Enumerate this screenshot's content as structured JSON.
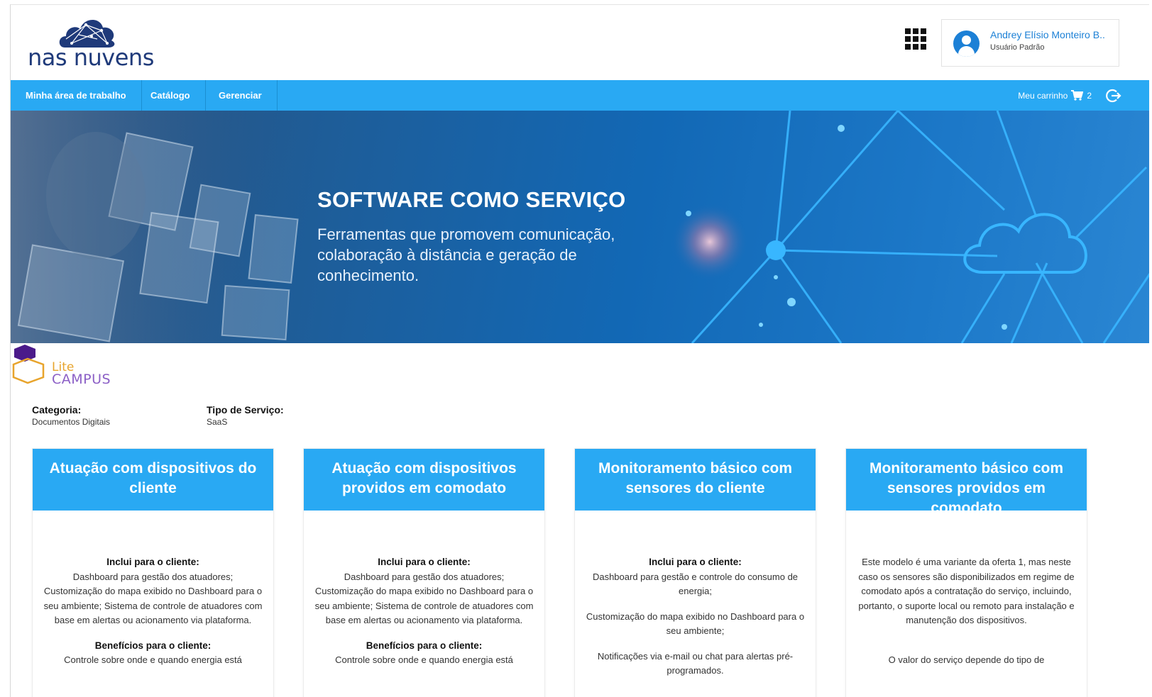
{
  "brand": {
    "logo_text": "nas nuvens"
  },
  "user": {
    "name": "Andrey Elísio Monteiro B..",
    "role": "Usuário Padrão"
  },
  "nav": {
    "items": [
      "Minha área de trabalho",
      "Catálogo",
      "Gerenciar"
    ],
    "cart_label": "Meu carrinho",
    "cart_count": "2"
  },
  "banner": {
    "title": "SOFTWARE COMO SERVIÇO",
    "subtitle": "Ferramentas que promovem comunicação, colaboração à distância e geração de conhecimento."
  },
  "product": {
    "logo_lite": "Lite",
    "logo_campus": "CAMPUS"
  },
  "meta": {
    "category_label": "Categoria:",
    "category_value": "Documentos Digitais",
    "service_type_label": "Tipo de Serviço:",
    "service_type_value": "SaaS"
  },
  "colors": {
    "accent": "#29a9f3",
    "brand": "#1f3a7a",
    "link": "#1c80d6"
  },
  "cards": [
    {
      "title": "Atuação com dispositivos do cliente",
      "includes_label": "Inclui para o cliente:",
      "includes_text": "Dashboard para gestão dos atuadores; Customização do mapa exibido no Dashboard para o seu ambiente; Sistema de controle de atuadores com base em alertas ou acionamento via plataforma.",
      "benefits_label": "Benefícios para o cliente:",
      "benefits_text": "Controle sobre onde e quando energia está"
    },
    {
      "title": "Atuação com dispositivos providos em comodato",
      "includes_label": "Inclui para o cliente:",
      "includes_text": "Dashboard para gestão dos atuadores; Customização do mapa exibido no Dashboard para o seu ambiente; Sistema de controle de atuadores com base em alertas ou acionamento via plataforma.",
      "benefits_label": "Benefícios para o cliente:",
      "benefits_text": "Controle sobre onde e quando energia está"
    },
    {
      "title": "Monitoramento básico com sensores do cliente",
      "includes_label": "Inclui para o cliente:",
      "paragraphs": [
        "Dashboard para gestão e controle do consumo de energia;",
        "Customização do mapa exibido no Dashboard para o seu ambiente;",
        "Notificações via e-mail ou chat para alertas pré-programados."
      ]
    },
    {
      "title": "Monitoramento básico com sensores providos em comodato",
      "paragraphs": [
        "Este modelo é uma variante da oferta 1, mas neste caso os sensores são disponibilizados em regime de comodato após a contratação do serviço, incluindo, portanto, o suporte local ou remoto para instalação e manutenção dos dispositivos.",
        "O valor do serviço depende do tipo de"
      ]
    }
  ]
}
